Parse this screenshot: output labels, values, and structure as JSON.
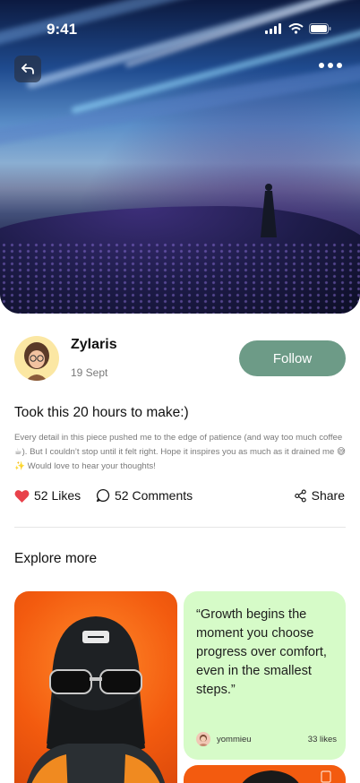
{
  "status_bar": {
    "time": "9:41"
  },
  "post": {
    "author": "Zylaris",
    "date": "19 Sept",
    "follow_label": "Follow",
    "title": "Took this 20 hours to make:)",
    "body": "Every detail in this piece pushed me to the edge of patience (and way too much coffee ☕). But I couldn’t stop until it felt right. Hope it inspires you as much as it drained me 😅✨ Would love to hear your thoughts!",
    "likes_label": "52 Likes",
    "comments_label": "52 Comments",
    "share_label": "Share"
  },
  "explore": {
    "title": "Explore more",
    "quote_card": {
      "quote": "“Growth begins the moment you choose progress over comfort, even in the smallest steps.”",
      "user": "yommieu",
      "likes": "33 likes",
      "background": "#d6fbc8"
    }
  },
  "colors": {
    "accent": "#6d9b87",
    "like": "#e8414a",
    "card_orange": "#f35b0f"
  },
  "icons": [
    "back-arrow-icon",
    "more-dots-icon",
    "signal-icon",
    "wifi-icon",
    "battery-icon",
    "heart-icon",
    "comment-icon",
    "share-icon"
  ]
}
